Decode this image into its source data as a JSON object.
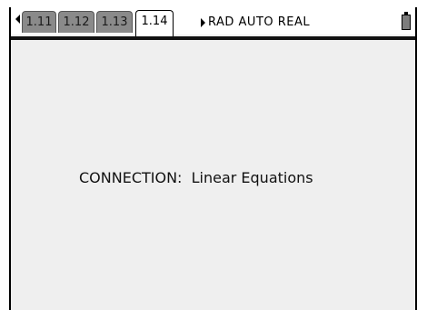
{
  "tabs": [
    {
      "label": "1.11",
      "active": false
    },
    {
      "label": "1.12",
      "active": false
    },
    {
      "label": "1.13",
      "active": false
    },
    {
      "label": "1.14",
      "active": true
    }
  ],
  "status": {
    "text": "RAD  AUTO  REAL"
  },
  "page": {
    "text": "CONNECTION:  Linear Equations"
  },
  "icons": {
    "prev": "left-arrow-icon",
    "next": "right-arrow-icon",
    "battery": "battery-icon"
  }
}
